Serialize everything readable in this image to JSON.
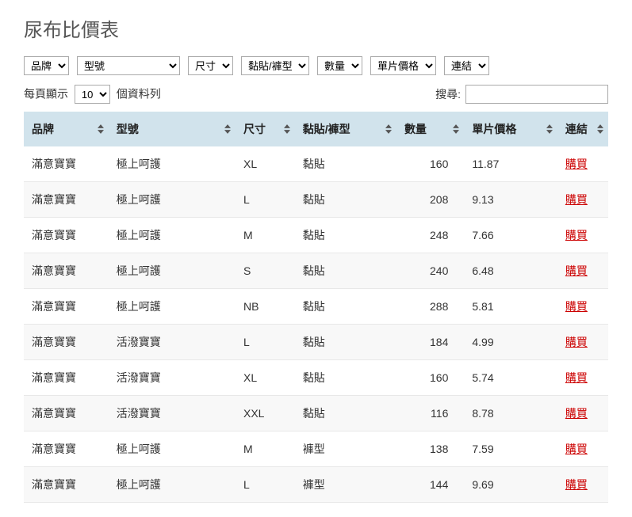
{
  "title": "尿布比價表",
  "filters": {
    "brand": "品牌",
    "model": "型號",
    "size": "尺寸",
    "type": "黏貼/褲型",
    "quantity": "數量",
    "unit_price": "單片價格",
    "link": "連結"
  },
  "page_length": {
    "prefix": "每頁顯示",
    "value": "10",
    "suffix": "個資料列"
  },
  "search": {
    "label": "搜尋:",
    "value": ""
  },
  "columns": {
    "brand": "品牌",
    "model": "型號",
    "size": "尺寸",
    "type": "黏貼/褲型",
    "quantity": "數量",
    "unit_price": "單片價格",
    "link": "連結"
  },
  "link_label": "購買",
  "rows": [
    {
      "brand": "滿意寶寶",
      "model": "極上呵護",
      "size": "XL",
      "type": "黏貼",
      "quantity": "160",
      "unit_price": "11.87"
    },
    {
      "brand": "滿意寶寶",
      "model": "極上呵護",
      "size": "L",
      "type": "黏貼",
      "quantity": "208",
      "unit_price": "9.13"
    },
    {
      "brand": "滿意寶寶",
      "model": "極上呵護",
      "size": "M",
      "type": "黏貼",
      "quantity": "248",
      "unit_price": "7.66"
    },
    {
      "brand": "滿意寶寶",
      "model": "極上呵護",
      "size": "S",
      "type": "黏貼",
      "quantity": "240",
      "unit_price": "6.48"
    },
    {
      "brand": "滿意寶寶",
      "model": "極上呵護",
      "size": "NB",
      "type": "黏貼",
      "quantity": "288",
      "unit_price": "5.81"
    },
    {
      "brand": "滿意寶寶",
      "model": "活潑寶寶",
      "size": "L",
      "type": "黏貼",
      "quantity": "184",
      "unit_price": "4.99"
    },
    {
      "brand": "滿意寶寶",
      "model": "活潑寶寶",
      "size": "XL",
      "type": "黏貼",
      "quantity": "160",
      "unit_price": "5.74"
    },
    {
      "brand": "滿意寶寶",
      "model": "活潑寶寶",
      "size": "XXL",
      "type": "黏貼",
      "quantity": "116",
      "unit_price": "8.78"
    },
    {
      "brand": "滿意寶寶",
      "model": "極上呵護",
      "size": "M",
      "type": "褲型",
      "quantity": "138",
      "unit_price": "7.59"
    },
    {
      "brand": "滿意寶寶",
      "model": "極上呵護",
      "size": "L",
      "type": "褲型",
      "quantity": "144",
      "unit_price": "9.69"
    }
  ]
}
